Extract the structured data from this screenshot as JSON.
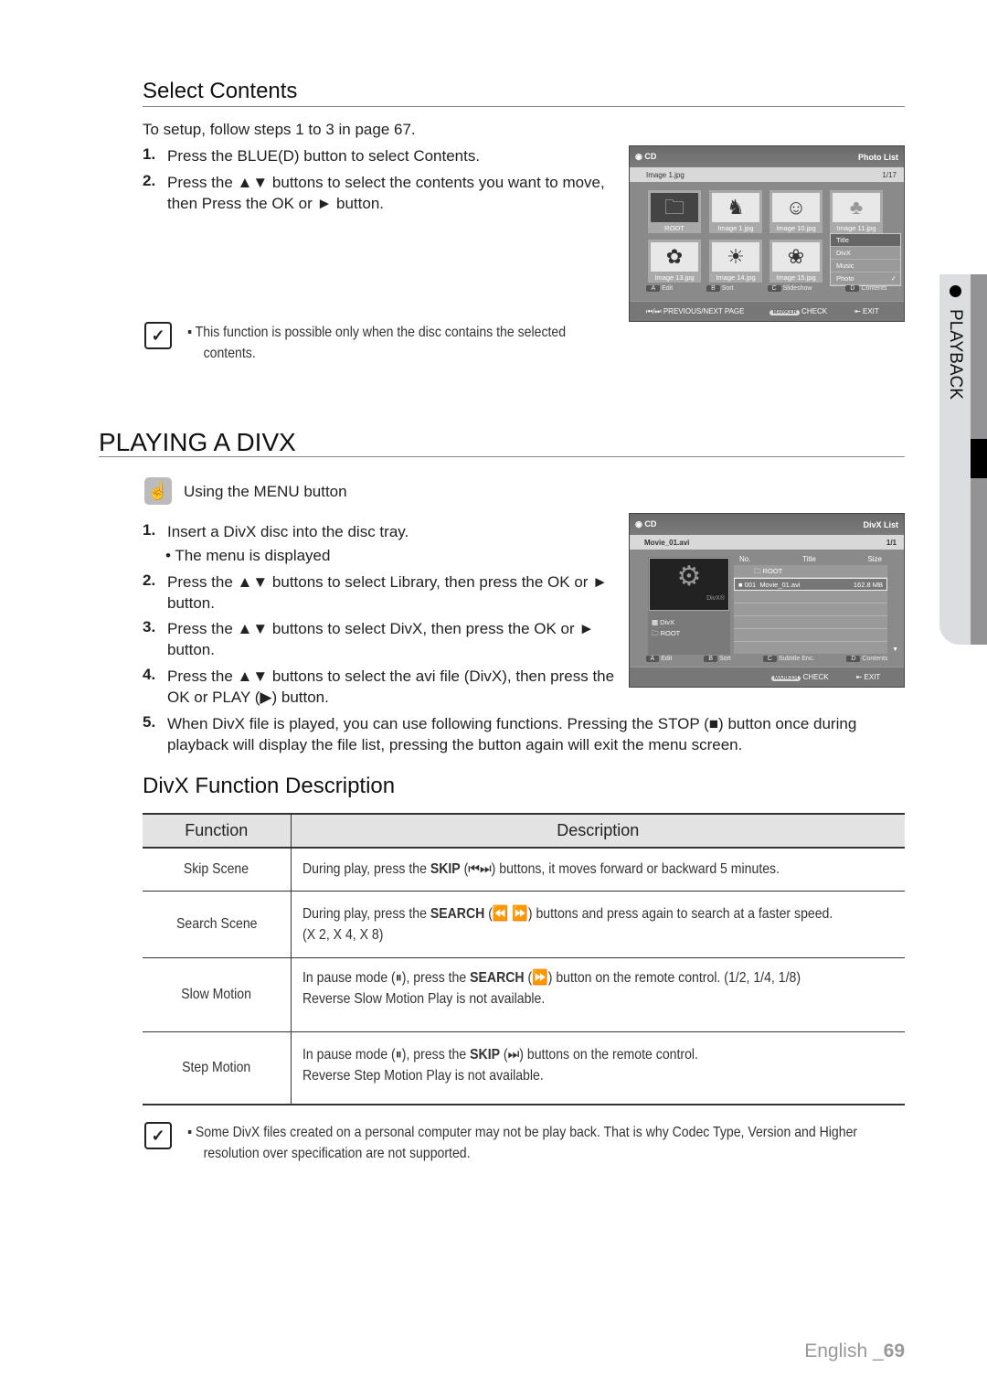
{
  "select": {
    "title": "Select Contents",
    "intro": "To setup, follow steps 1 to 3 in page 67.",
    "step1": {
      "n": "1.",
      "a": "Press the ",
      "b": "BLUE(D)",
      "c": " button to select ",
      "d": "Contents",
      "e": "."
    },
    "step2": {
      "n": "2.",
      "l1": "Press the ▲▼ buttons to select the contents you want to move,",
      "l2a": "then Press the ",
      "l2b": "OK",
      "l2c": " or ► button."
    },
    "note": {
      "l1": "▪  This function is possible only when the disc contains the selected",
      "l2": "contents."
    }
  },
  "photo_screen": {
    "source": "CD",
    "title": "Photo List",
    "file": "Image 1.jpg",
    "page": "1/17",
    "thumbs": [
      "ROOT",
      "Image 1.jpg",
      "Image 10.jpg",
      "Image 11.jpg",
      "Image 13.jpg",
      "Image 14.jpg",
      "Image 15.jpg"
    ],
    "menu": [
      "Title",
      "DivX",
      "Music",
      "Photo"
    ],
    "checked": "✓",
    "keys": [
      {
        "k": "A",
        "l": "Edit"
      },
      {
        "k": "B",
        "l": "Sort"
      },
      {
        "k": "C",
        "l": "Slideshow"
      },
      {
        "k": "D",
        "l": "Contents"
      }
    ],
    "foot": {
      "prev": "⏮/⏭ PREVIOUS/NEXT PAGE",
      "marker": "MARKER",
      "check": "CHECK",
      "exit": "EXIT"
    }
  },
  "divx": {
    "title": "PLAYING A DIVX",
    "menu_label": "Using the MENU button",
    "s1": {
      "n": "1.",
      "t": "Insert a DivX disc into the disc tray.",
      "bullet": "• The menu is displayed"
    },
    "s2": {
      "n": "2.",
      "a": "Press the ▲▼ buttons to select ",
      "b": "Library",
      "c": ", then press the ",
      "d": "OK",
      "e": " or ►",
      "l2": "button."
    },
    "s3": {
      "n": "3.",
      "a": "Press the ▲▼ buttons to select ",
      "b": "DivX",
      "c": ", then press the ",
      "d": "OK",
      "e": " or ►",
      "l2": "button."
    },
    "s4": {
      "n": "4.",
      "l1": "Press the ▲▼ buttons to select the avi file (DivX), then press the",
      "a": "OK",
      "b": " or ",
      "c": "PLAY",
      "d": " (▶) button."
    },
    "s5": {
      "n": "5.",
      "a": "When DivX file is played, you can use following functions. Pressing the ",
      "b": "STOP",
      "c": " (■) button once during",
      "l2": "playback will display the file list, pressing the button again will exit the menu screen."
    }
  },
  "divx_screen": {
    "source": "CD",
    "title": "DivX List",
    "file": "Movie_01.avi",
    "page": "1/1",
    "cols": [
      "No.",
      "Title",
      "Size"
    ],
    "root": "ROOT",
    "row": {
      "no": "001",
      "title": "Movie_01.avi",
      "size": "162.8 MB"
    },
    "logo": "DivX®",
    "tree": [
      "DivX",
      "ROOT"
    ],
    "keys": [
      {
        "k": "A",
        "l": "Edit"
      },
      {
        "k": "B",
        "l": "Sort"
      },
      {
        "k": "C",
        "l": "Subtitle Enc."
      },
      {
        "k": "D",
        "l": "Contents"
      }
    ],
    "foot": {
      "marker": "MARKER",
      "check": "CHECK",
      "exit": "EXIT"
    }
  },
  "func": {
    "title": "DivX Function Description",
    "headers": [
      "Function",
      "Description"
    ],
    "rows": [
      {
        "f": "Skip Scene",
        "a": "During play, press the ",
        "k": "SKIP",
        "i": "(⏮⏭)",
        "b": " buttons, it moves forward or backward 5 minutes.",
        "l2": ""
      },
      {
        "f": "Search Scene",
        "a": "During play, press the ",
        "k": "SEARCH",
        "i": "(⏪ ⏩)",
        "b": " buttons and press again to search at a faster speed.",
        "l2": "(X 2, X 4, X 8)"
      },
      {
        "f": "Slow Motion",
        "a": "In pause mode (⏸), press the ",
        "k": "SEARCH",
        "i": "(⏩)",
        "b": " button on the remote control.  (1/2, 1/4, 1/8)",
        "l2": "Reverse Slow Motion Play is not available."
      },
      {
        "f": "Step Motion",
        "a": "In pause mode (⏸), press the ",
        "k": "SKIP",
        "i": "(⏭)",
        "b": " buttons on the remote control.",
        "l2": "Reverse Step Motion Play is not available."
      }
    ]
  },
  "note2": {
    "l1": "▪  Some DivX files created on a personal computer may not be play back. That is why Codec Type, Version and Higher",
    "l2": "resolution over specification are not supported."
  },
  "side_tab": {
    "label": "PLAYBACK"
  },
  "footer": {
    "lang": "English _",
    "page": "69"
  }
}
